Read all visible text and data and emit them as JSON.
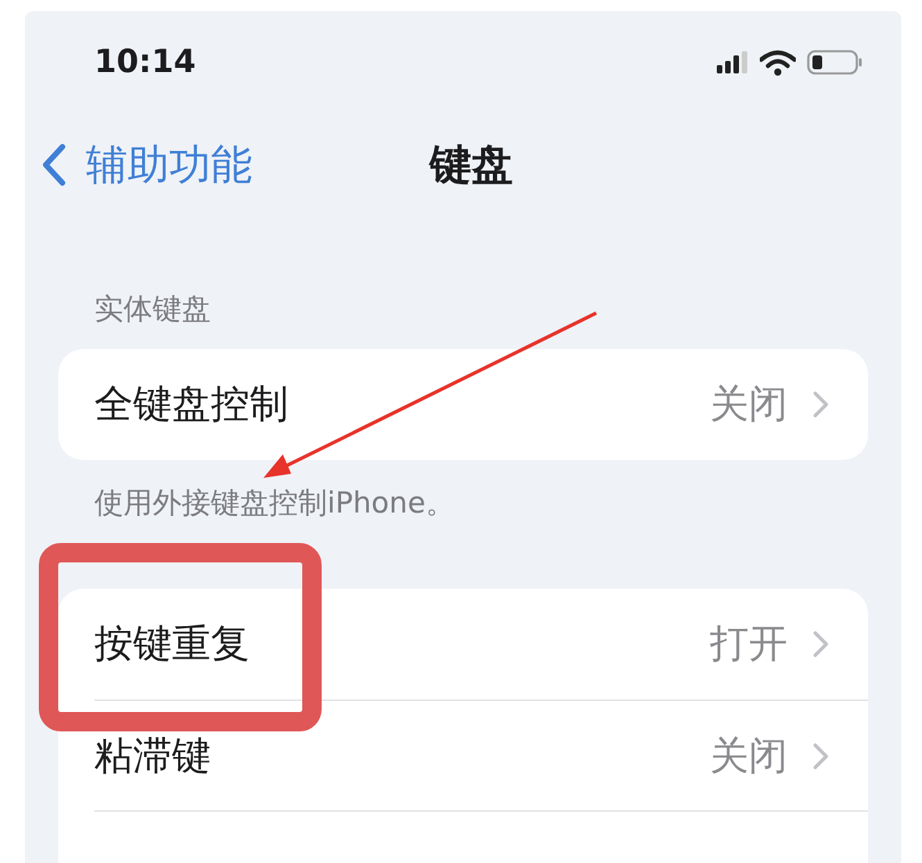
{
  "status_bar": {
    "time": "10:14"
  },
  "nav": {
    "back_label": "辅助功能",
    "title": "键盘"
  },
  "sections": [
    {
      "header": "实体键盘",
      "footer": "使用外接键盘控制iPhone。",
      "rows": [
        {
          "label": "全键盘控制",
          "value": "关闭"
        }
      ]
    },
    {
      "rows": [
        {
          "label": "按键重复",
          "value": "打开"
        },
        {
          "label": "粘滞键",
          "value": "关闭"
        }
      ]
    }
  ],
  "annotations": {
    "arrow": true,
    "highlight_box": true
  }
}
